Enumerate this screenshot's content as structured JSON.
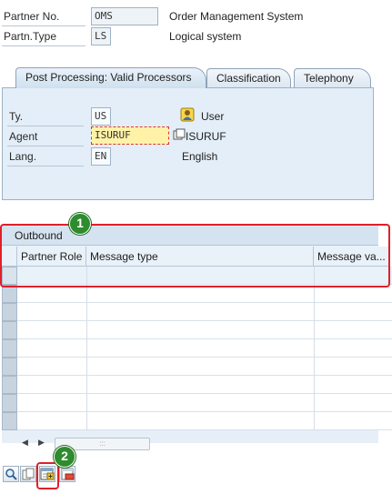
{
  "header": {
    "partner_no_label": "Partner No.",
    "partner_no_value": "OMS",
    "partner_no_desc": "Order Management System",
    "partner_type_label": "Partn.Type",
    "partner_type_value": "LS",
    "partner_type_desc": "Logical system"
  },
  "tabs": [
    {
      "label": "Post Processing: Valid Processors",
      "active": true
    },
    {
      "label": "Classification",
      "active": false
    },
    {
      "label": "Telephony",
      "active": false
    }
  ],
  "processors": {
    "type_label": "Ty.",
    "type_value": "US",
    "type_desc": "User",
    "agent_label": "Agent",
    "agent_value": "ISURUF",
    "agent_desc": "ISURUF",
    "lang_label": "Lang.",
    "lang_value": "EN",
    "lang_desc": "English"
  },
  "outbound": {
    "title": "Outbound",
    "columns": [
      "Partner Role",
      "Message type",
      "Message va..."
    ]
  },
  "annotations": {
    "badge_1": "1",
    "badge_2": "2",
    "accent": "#e0202a",
    "badge_color": "#2e8b2e"
  },
  "scroll": {
    "grip": ":::"
  },
  "toolbar": {
    "icons": [
      "zoom-icon",
      "copy-icon",
      "create-outbound-parameter-icon",
      "delete-icon"
    ]
  }
}
